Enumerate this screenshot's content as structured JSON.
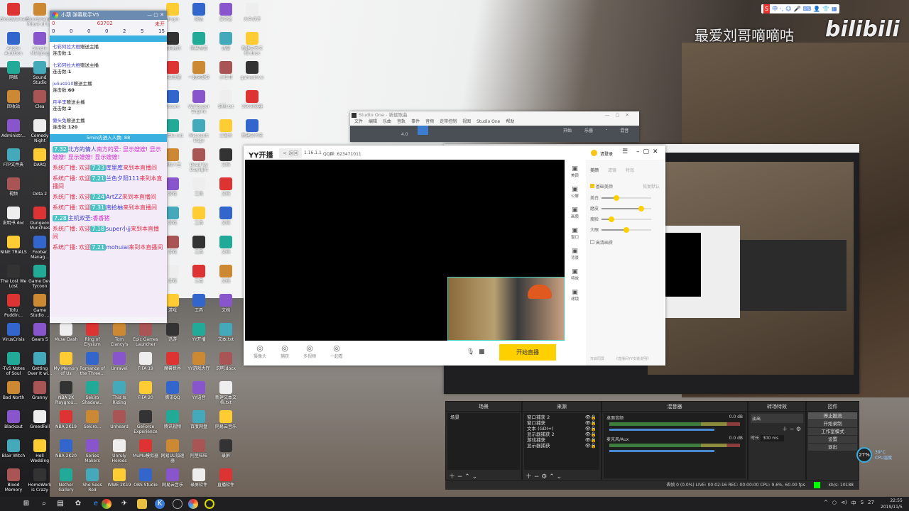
{
  "desktop": {
    "columns": [
      {
        "start": 0,
        "items": [
          "Bloodstained",
          "Adobe Audition",
          "网络",
          "回收站",
          "Administr...",
          "FTP文件夹",
          "视频",
          "说明书.doc",
          "NINE TRIALS",
          "The Lost We Lost",
          "Tofu Puddin...",
          "VirusCrisis",
          "-TvS Notes of Soul",
          "Bad North",
          "Blackout",
          "Blair Witch",
          "Blood Memory"
        ]
      },
      {
        "start": 0,
        "items": [
          "Bloodstained: Ritual of t...",
          "Simple Mahjong",
          "Sound Studio",
          "Clea",
          "Comedy Night",
          "DARQ",
          "Dota 2",
          "Dungeon Munchies",
          "Foobar Manag...",
          "Game Dev Tycoon",
          "Game Studio ...",
          "Gears 5",
          "Getting Over It wi...",
          "Granny",
          "GreedFall",
          "Hell Wedding",
          "HomeWork is Crazy"
        ]
      },
      {
        "start": 11,
        "items": [
          "Muse Dash",
          "My Memory of Us",
          "NBA 2K Playgrou...",
          "NBA 2K19",
          "NBA 2K20",
          "Nether Gallery"
        ]
      },
      {
        "start": 11,
        "items": [
          "Ring of Elysium",
          "Romance of the Three...",
          "Sekiro Shadow...",
          "Sekiro...",
          "Series Makers",
          "She Sees Red"
        ]
      },
      {
        "start": 11,
        "items": [
          "Tom Clancy's",
          "Unravel",
          "This Is Riding",
          "Unheard",
          "Unruly Heroes",
          "WWE 2K19"
        ]
      },
      {
        "start": 11,
        "items": [
          "Epic Games Launcher",
          "FIFA 19",
          "FIFA 20",
          "GeForce Experience",
          "MuMu模拟器",
          "OBS Studio"
        ]
      },
      {
        "start": 0,
        "items": [
          "Origin",
          "酷狗音乐",
          "英雄联盟",
          "Steam",
          "Battle.net",
          "模拟人生",
          "游戏",
          "游戏",
          "游戏",
          "游戏",
          "游戏",
          "迅游",
          "魔兽世界",
          "腾讯QQ",
          "腾讯视频",
          "网易UU加速器",
          "网易云音乐"
        ]
      },
      {
        "start": 0,
        "items": [
          "微信",
          "网易有道",
          "一起来捉妖",
          "Wallpaper Engine",
          "Microsoft Edge",
          "Dead by Daylight",
          "工具",
          "工具",
          "工具",
          "工具",
          "工具",
          "YY开播",
          "YY游戏大厅",
          "YY语音",
          "百度网盘",
          "阿里旺旺",
          "录屏软件"
        ]
      },
      {
        "start": 0,
        "items": [
          "爱奇艺",
          "迅雷",
          "小红书",
          "说明.txt",
          "三国杀",
          "文档",
          "文档",
          "文档",
          "文档",
          "文档",
          "文档",
          "文本.txt",
          "说明.docx",
          "新建文本文档.txt",
          "网易云音乐",
          "录屏",
          "直播软件"
        ]
      },
      {
        "start": 0,
        "items": [
          "大众点评",
          "新建文本文档.docx",
          "gamedrive",
          "360浏览器",
          "新建文件夹"
        ]
      }
    ]
  },
  "chat_window": {
    "title": "小葫 弹幕助手V5",
    "stats": [
      "0",
      "63702",
      "未开"
    ],
    "badges": [
      "0",
      "0",
      "0",
      "0",
      "2",
      "5",
      "15"
    ],
    "gifts": [
      {
        "user": "七彩阿拉大橙",
        "text": "赠送主播",
        "count_label": "连击数:",
        "count": "1"
      },
      {
        "user": "七彩阿拉大橙",
        "text": "赠送主播",
        "count_label": "连击数:",
        "count": "1"
      },
      {
        "user": "julius910",
        "text": "赠送主播",
        "count_label": "连击数:",
        "count": "60"
      },
      {
        "user": "月半李",
        "text": "赠送主播",
        "count_label": "连击数:",
        "count": "2"
      },
      {
        "user": "懒头兔",
        "text": "赠送主播",
        "count_label": "连击数:",
        "count": "120"
      }
    ],
    "enter_count": "5min内进入人数: 88",
    "messages": [
      {
        "pre": "",
        "badge": "7.32",
        "name": "北方的情人",
        "text": "南方的爱: 显示嫂嫂! 显示嫂嫂! 显示嫂嫂! 显示嫂嫂!",
        "post": ""
      },
      {
        "pre": "系统广播: 欢迎",
        "badge": "7.23",
        "name": "库里库",
        "text": "",
        "post": "来到本直播间"
      },
      {
        "pre": "系统广播: 欢迎",
        "badge": "7.21",
        "name": "兰色夕阳111",
        "text": "",
        "post": "来到本直播间"
      },
      {
        "pre": "系统广播: 欢迎",
        "badge": "7.24",
        "name": "ArtZZ",
        "text": "",
        "post": "来到本直播间"
      },
      {
        "pre": "系统广播: 欢迎",
        "badge": "7.31",
        "name": "南拾柚",
        "text": "",
        "post": "来到本直播间"
      },
      {
        "pre": "",
        "badge": "7.28",
        "name": "主机双圣:",
        "text": "香香猪",
        "post": ""
      },
      {
        "pre": "系统广播: 欢迎",
        "badge": "7.18",
        "name": "super小jj",
        "text": "",
        "post": "来到本直播间"
      },
      {
        "pre": "系统广播: 欢迎",
        "badge": "7.21",
        "name": "mohuiai",
        "text": "",
        "post": "来到本直播间"
      }
    ]
  },
  "studio_one": {
    "title": "Studio One - 新建歌曲",
    "menu": [
      "文件",
      "编辑",
      "乐曲",
      "音轨",
      "事件",
      "音频",
      "走带控制",
      "视图",
      "Studio One",
      "帮助"
    ],
    "toolbar_right": [
      "开始",
      "乐器",
      "-",
      "混音"
    ],
    "value": "4.0"
  },
  "yy": {
    "logo": "YY开播",
    "back": "< 返回",
    "version": "1.16.1.1",
    "qq": "QQ群: 623471011",
    "login": "请登录",
    "side": [
      "美颜",
      "公屏",
      "画质",
      "窗口",
      "背景",
      "特效",
      "滤镜"
    ],
    "tabs": [
      "美颜",
      "滤镜",
      "特效"
    ],
    "beauty_toggle": "基础美颜",
    "reset": "恢复默认",
    "sliders": [
      {
        "label": "美白",
        "value": 0.3
      },
      {
        "label": "磨皮",
        "value": 0.8
      },
      {
        "label": "瘦脸",
        "value": 0.2
      },
      {
        "label": "大眼",
        "value": 0.5
      }
    ],
    "hd": "高清画质",
    "bottom": [
      "摄像头",
      "捕获",
      "多视频",
      "一起看"
    ],
    "start": "开始直播",
    "footer": [
      "开启同屏",
      "《直播间YY安装说明》"
    ]
  },
  "obs": {
    "docks": [
      "场景",
      "来源",
      "混音器",
      "转场特效",
      "控件"
    ],
    "scenes": [
      "场景"
    ],
    "sources": [
      "窗口捕获 2",
      "窗口捕获",
      "文本 (GDI+)",
      "显示器捕获 2",
      "游戏捕获",
      "显示器捕获"
    ],
    "mixer": [
      {
        "name": "桌面音频",
        "db": "0.0 dB"
      },
      {
        "name": "麦克风/Aux",
        "db": "0.0 dB"
      }
    ],
    "transition": "淡出",
    "duration_label": "时长",
    "duration": "300 ms",
    "controls": [
      "停止推流",
      "开始录制",
      "工作室模式",
      "设置",
      "退出"
    ],
    "status": "丢帧 0 (0.0%)   LIVE: 00:02:16   REC: 00:00:00   CPU: 9.6%, 60.00 fps",
    "kbps": "kb/s: 10188"
  },
  "watermark": {
    "text": "最爱刘哥嘀嘀咕",
    "brand": "bilibili"
  },
  "sogou": [
    "S",
    "中",
    "·,",
    "☺",
    "🎤",
    "⌨",
    "👤",
    "👕",
    "▦"
  ],
  "cpu_widget": {
    "usage": "27%",
    "temp": "39°C",
    "label": "CPU温度"
  },
  "taskbar": {
    "time": "22:55",
    "date": "2019/11/5",
    "tray": [
      "^",
      "○",
      "⊲)",
      "中",
      "S",
      "27"
    ]
  }
}
